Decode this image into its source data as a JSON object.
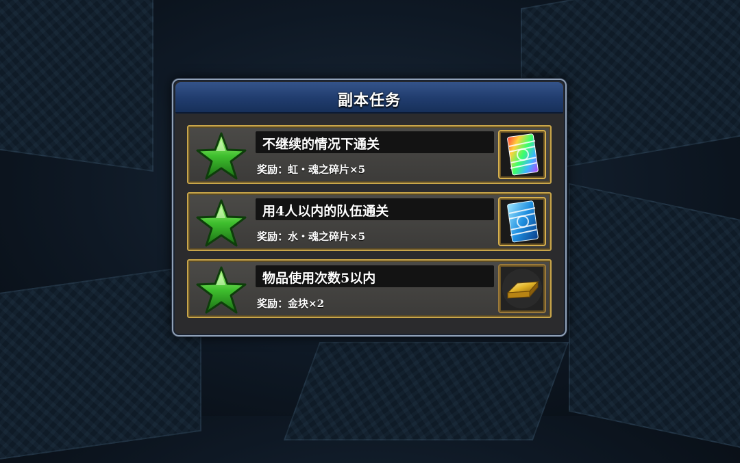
{
  "title": "副本任务",
  "missions": [
    {
      "condition": "不继续的情况下通关",
      "reward": "奖励：虹・魂之碎片×5",
      "reward_icon": "rainbow-soul-fragment-icon"
    },
    {
      "condition": "用4人以内的队伍通关",
      "reward": "奖励：水・魂之碎片×5",
      "reward_icon": "water-soul-fragment-icon"
    },
    {
      "condition": "物品使用次数5以内",
      "reward": "奖励：金块×2",
      "reward_icon": "gold-bar-icon"
    }
  ],
  "colors": {
    "header": "#203c6d",
    "frame_gold": "#c9a64a",
    "star_green": "#3fbf2e"
  }
}
